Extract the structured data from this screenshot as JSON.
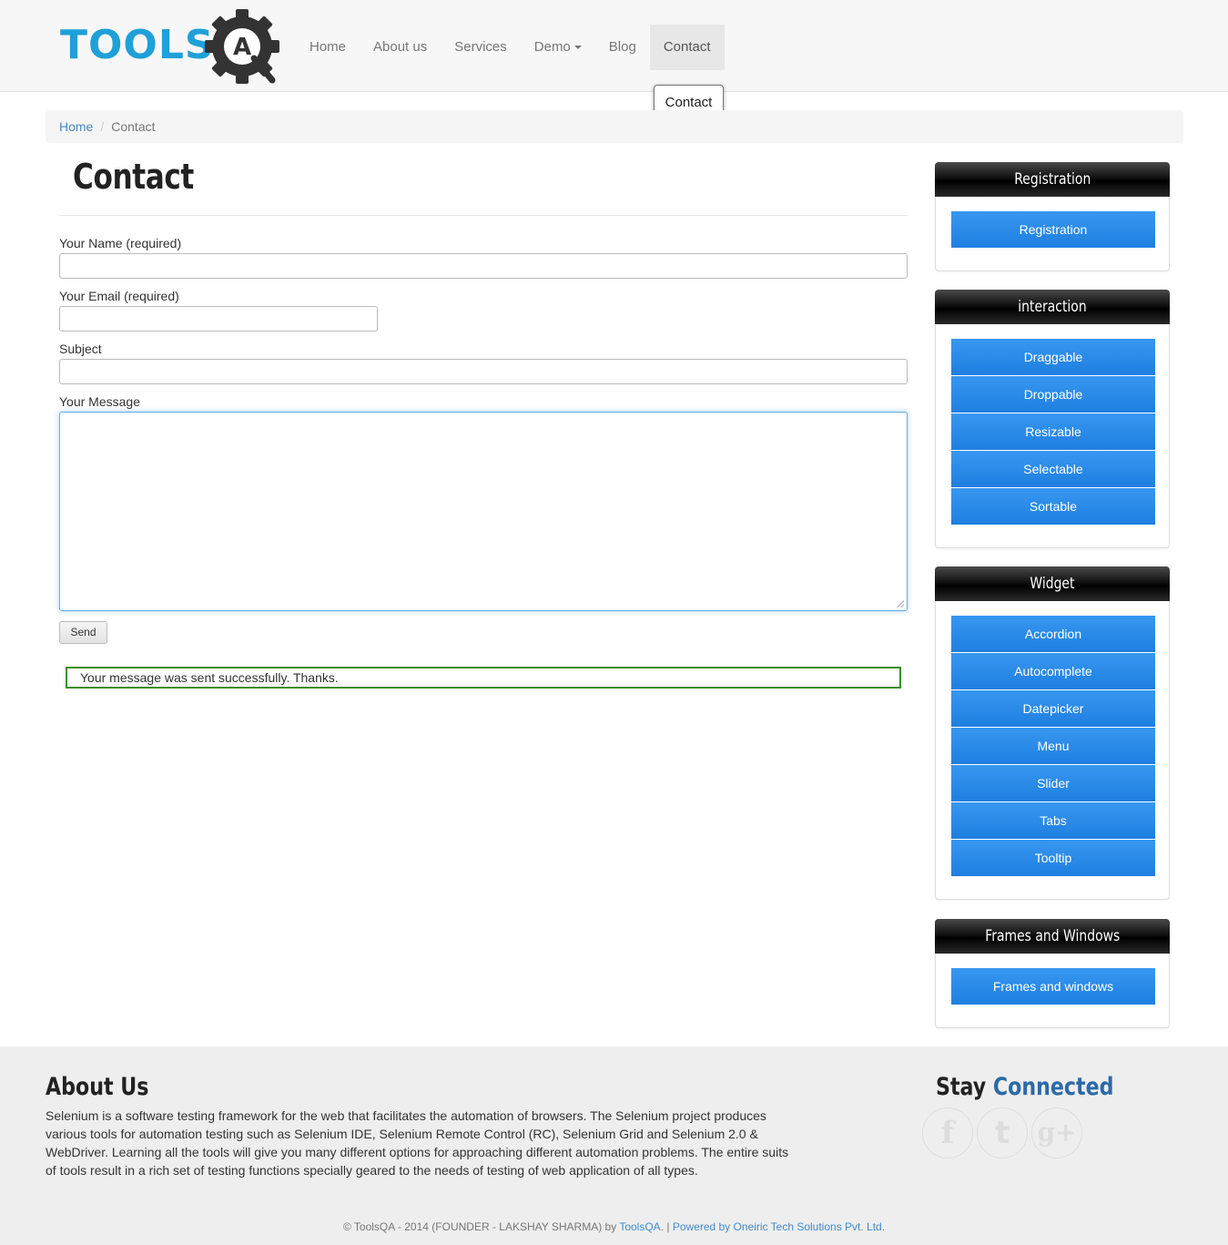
{
  "brand": {
    "logo_text": "TOOLS",
    "logo_letter": "A"
  },
  "nav": {
    "items": [
      {
        "label": "Home"
      },
      {
        "label": "About us"
      },
      {
        "label": "Services"
      },
      {
        "label": "Demo"
      },
      {
        "label": "Blog"
      },
      {
        "label": "Contact"
      }
    ],
    "tooltip": "Contact"
  },
  "breadcrumb": {
    "home": "Home",
    "separator": "/",
    "current": "Contact"
  },
  "page": {
    "title": "Contact"
  },
  "form": {
    "name_label": "Your Name (required)",
    "name_value": "",
    "email_label": "Your Email (required)",
    "email_value": "",
    "subject_label": "Subject",
    "subject_value": "",
    "message_label": "Your Message",
    "message_value": "",
    "send_label": "Send",
    "success_message": "Your message was sent successfully. Thanks."
  },
  "sidebar": {
    "registration": {
      "title": "Registration",
      "items": [
        "Registration"
      ]
    },
    "interaction": {
      "title": "interaction",
      "items": [
        "Draggable",
        "Droppable",
        "Resizable",
        "Selectable",
        "Sortable"
      ]
    },
    "widget": {
      "title": "Widget",
      "items": [
        "Accordion",
        "Autocomplete",
        "Datepicker",
        "Menu",
        "Slider",
        "Tabs",
        "Tooltip"
      ]
    },
    "frames": {
      "title": "Frames and Windows",
      "items": [
        "Frames and windows"
      ]
    }
  },
  "footer": {
    "about_title": "About Us",
    "about_text": "Selenium is a software testing framework for the web that facilitates the automation of browsers. The Selenium project produces various tools for automation testing such as Selenium IDE, Selenium Remote Control (RC), Selenium Grid and Selenium 2.0 & WebDriver. Learning all the tools will give you many different options for approaching different automation problems. The entire suits of tools result in a rich set of testing functions specially geared to the needs of testing of web application of all types.",
    "stay_title_1": "Stay",
    "stay_title_2": "Connected",
    "social": {
      "facebook": "f",
      "twitter": "t",
      "gplus": "g+"
    },
    "copyright_text": "© ToolsQA - 2014 (FOUNDER - LAKSHAY SHARMA) by ",
    "copyright_link": "ToolsQA",
    "copyright_sep": ". | ",
    "powered_by": "Powered by Oneiric Tech Solutions Pvt. Ltd."
  },
  "colors": {
    "brand_blue": "#1fa0d8",
    "button_blue": "#2486e6",
    "success_border": "#398f14",
    "link": "#428bca"
  }
}
